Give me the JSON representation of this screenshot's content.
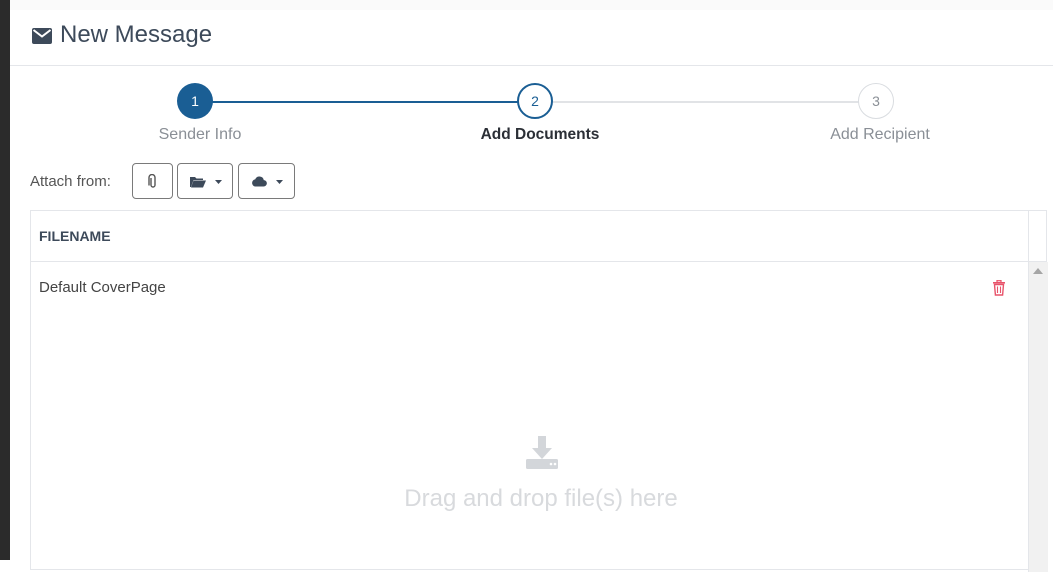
{
  "header": {
    "title": "New Message",
    "icon": "mail-icon"
  },
  "stepper": {
    "steps": [
      {
        "number": "1",
        "label": "Sender Info",
        "state": "completed"
      },
      {
        "number": "2",
        "label": "Add Documents",
        "state": "active"
      },
      {
        "number": "3",
        "label": "Add Recipient",
        "state": "pending"
      }
    ],
    "accent_color": "#1a5e94"
  },
  "attach": {
    "label": "Attach from:",
    "buttons": [
      {
        "icon": "paperclip-icon"
      },
      {
        "icon": "folder-open-icon",
        "dropdown": true
      },
      {
        "icon": "cloud-icon",
        "dropdown": true
      }
    ]
  },
  "table": {
    "column_header": "FILENAME",
    "rows": [
      {
        "filename": "Default CoverPage",
        "action_icon": "trash-icon"
      }
    ]
  },
  "dropzone": {
    "text": "Drag and drop file(s) here",
    "icon": "download-icon"
  }
}
